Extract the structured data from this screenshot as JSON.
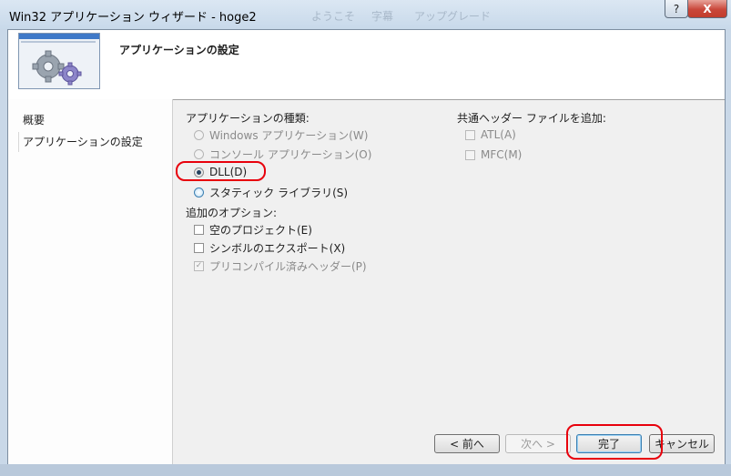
{
  "window": {
    "title": "Win32 アプリケーション ウィザード - hoge2",
    "ghost_tabs": [
      "ようこそ",
      "字幕",
      "アップグレード"
    ],
    "help_label": "?",
    "close_label": "X"
  },
  "header": {
    "title": "アプリケーションの設定"
  },
  "nav": {
    "items": [
      {
        "label": "概要"
      },
      {
        "label": "アプリケーションの設定"
      }
    ]
  },
  "app_type": {
    "label": "アプリケーションの種類:",
    "options": [
      {
        "label": "Windows アプリケーション(W)",
        "checked": false,
        "enabled": false
      },
      {
        "label": "コンソール アプリケーション(O)",
        "checked": false,
        "enabled": false
      },
      {
        "label": "DLL(D)",
        "checked": true,
        "enabled": true
      },
      {
        "label": "スタティック ライブラリ(S)",
        "checked": false,
        "enabled": true
      }
    ]
  },
  "extra_options": {
    "label": "追加のオプション:",
    "options": [
      {
        "label": "空のプロジェクト(E)",
        "checked": false,
        "enabled": true
      },
      {
        "label": "シンボルのエクスポート(X)",
        "checked": false,
        "enabled": true
      },
      {
        "label": "プリコンパイル済みヘッダー(P)",
        "checked": true,
        "enabled": false
      }
    ]
  },
  "common_headers": {
    "label": "共通ヘッダー ファイルを追加:",
    "options": [
      {
        "label": "ATL(A)",
        "checked": false,
        "enabled": false
      },
      {
        "label": "MFC(M)",
        "checked": false,
        "enabled": false
      }
    ]
  },
  "buttons": {
    "back": "< 前へ",
    "next": "次へ >",
    "finish": "完了",
    "cancel": "キャンセル"
  },
  "colors": {
    "annotation_red": "#e8000c",
    "client_bg": "#f0f0f0"
  }
}
